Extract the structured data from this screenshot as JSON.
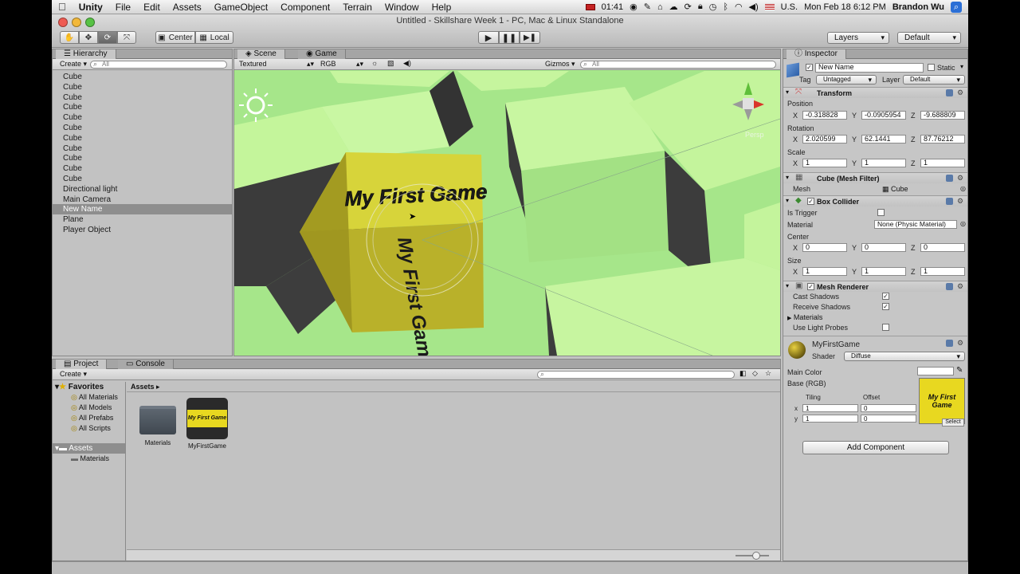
{
  "menubar": {
    "apple": "",
    "app": "Unity",
    "items": [
      "File",
      "Edit",
      "Assets",
      "GameObject",
      "Component",
      "Terrain",
      "Window",
      "Help"
    ],
    "battery_time": "01:41",
    "locale": "U.S.",
    "clock": "Mon Feb 18  6:12 PM",
    "user": "Brandon Wu"
  },
  "window": {
    "title": "Untitled - Skillshare Week 1 - PC, Mac & Linux Standalone"
  },
  "toolbar": {
    "pivot_center": "Center",
    "pivot_local": "Local",
    "layers": "Layers",
    "layout": "Default"
  },
  "hierarchy": {
    "tab": "Hierarchy",
    "create": "Create",
    "search_placeholder": "All",
    "items": [
      "Cube",
      "Cube",
      "Cube",
      "Cube",
      "Cube",
      "Cube",
      "Cube",
      "Cube",
      "Cube",
      "Cube",
      "Cube",
      "Directional light",
      "Main Camera",
      "New Name",
      "Plane",
      "Player Object"
    ],
    "selected_index": 13
  },
  "scene": {
    "tab_scene": "Scene",
    "tab_game": "Game",
    "render_mode": "Textured",
    "color_mode": "RGB",
    "gizmos": "Gizmos",
    "search_placeholder": "All",
    "view_label": "Persp",
    "cube_text": "My First Game"
  },
  "project": {
    "tab_project": "Project",
    "tab_console": "Console",
    "create": "Create",
    "favorites": "Favorites",
    "favorite_items": [
      "All Materials",
      "All Models",
      "All Prefabs",
      "All Scripts"
    ],
    "assets": "Assets",
    "asset_folders": [
      "Materials"
    ],
    "breadcrumb": "Assets",
    "files": [
      "Materials",
      "MyFirstGame"
    ],
    "thumb_text": "My First Game"
  },
  "inspector": {
    "tab": "Inspector",
    "name": "New Name",
    "static": "Static",
    "tag_label": "Tag",
    "tag": "Untagged",
    "layer_label": "Layer",
    "layer": "Default",
    "transform": {
      "title": "Transform",
      "position_label": "Position",
      "position": {
        "x": "-0.318828",
        "y": "-0.0905954",
        "z": "-9.688809"
      },
      "rotation_label": "Rotation",
      "rotation": {
        "x": "2.020599",
        "y": "62.1441",
        "z": "87.76212"
      },
      "scale_label": "Scale",
      "scale": {
        "x": "1",
        "y": "1",
        "z": "1"
      }
    },
    "mesh_filter": {
      "title": "Cube (Mesh Filter)",
      "mesh_label": "Mesh",
      "mesh": "Cube"
    },
    "box_collider": {
      "title": "Box Collider",
      "is_trigger": "Is Trigger",
      "material_label": "Material",
      "material": "None (Physic Material)",
      "center_label": "Center",
      "center": {
        "x": "0",
        "y": "0",
        "z": "0"
      },
      "size_label": "Size",
      "size": {
        "x": "1",
        "y": "1",
        "z": "1"
      }
    },
    "mesh_renderer": {
      "title": "Mesh Renderer",
      "cast_shadows": "Cast Shadows",
      "receive_shadows": "Receive Shadows",
      "materials": "Materials",
      "light_probes": "Use Light Probes"
    },
    "material": {
      "name": "MyFirstGame",
      "shader_label": "Shader",
      "shader": "Diffuse",
      "main_color": "Main Color",
      "base": "Base (RGB)",
      "tiling": "Tiling",
      "offset": "Offset",
      "tiling_x": "1",
      "tiling_y": "1",
      "offset_x": "0",
      "offset_y": "0",
      "select": "Select",
      "thumb_text": "My First Game"
    },
    "add_component": "Add Component"
  },
  "axis_labels": {
    "x": "X",
    "y": "Y",
    "z": "Z"
  },
  "colors": {
    "ground": "#a9ea8d",
    "cube_face": "#c7f59f",
    "cube_shadow": "#3a3a3a",
    "textured_cube": "#d4d22a"
  }
}
